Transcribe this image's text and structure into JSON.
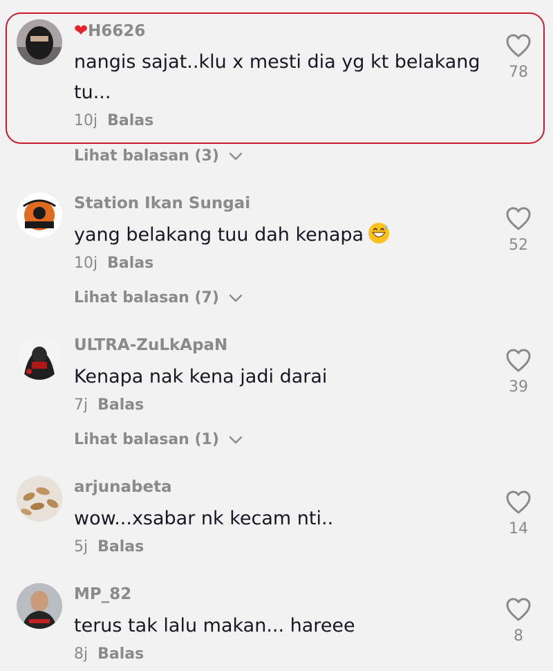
{
  "colors": {
    "background": "#f2f2f2",
    "highlight": "#c8192f",
    "text": "#161823",
    "muted": "#8a8a8a",
    "heart": "#e8222a"
  },
  "comments": [
    {
      "username_prefix_icon": "heart-icon",
      "username": "H6626",
      "text": "nangis sajat..klu x mesti dia yg kt belakang tu...",
      "time": "10j",
      "reply_label": "Balas",
      "likes": "78",
      "view_replies": "Lihat balasan (3)",
      "highlighted": true
    },
    {
      "username": "Station Ikan Sungai",
      "text": "yang belakang tuu dah kenapa",
      "trailing_emoji": "grinning-sweat-emoji",
      "time": "10j",
      "reply_label": "Balas",
      "likes": "52",
      "view_replies": "Lihat balasan (7)"
    },
    {
      "username": "ULTRA-ZuLkApaN",
      "text": "Kenapa nak kena jadi darai",
      "time": "7j",
      "reply_label": "Balas",
      "likes": "39",
      "view_replies": "Lihat balasan (1)"
    },
    {
      "username": "arjunabeta",
      "text": "wow...xsabar nk kecam nti..",
      "time": "5j",
      "reply_label": "Balas",
      "likes": "14"
    },
    {
      "username": "MP_82",
      "text": "terus tak lalu makan... hareee",
      "time": "8j",
      "reply_label": "Balas",
      "likes": "8"
    }
  ]
}
